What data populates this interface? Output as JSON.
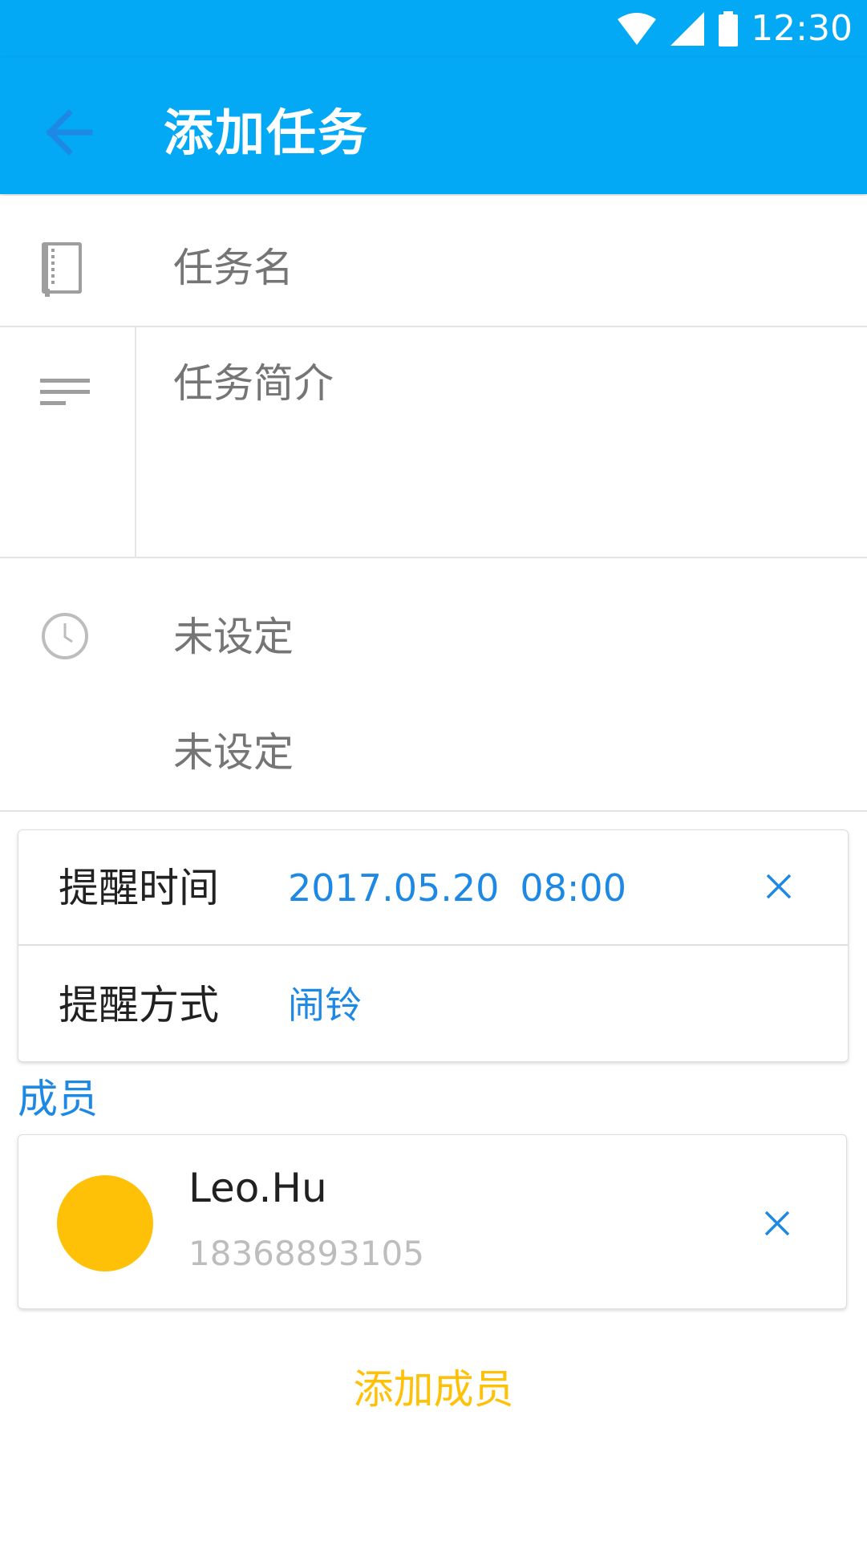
{
  "status_bar": {
    "time": "12:30",
    "icons": [
      "wifi-icon",
      "signal-icon",
      "battery-icon"
    ]
  },
  "app_bar": {
    "title": "添加任务",
    "back_icon": "arrow-back-icon"
  },
  "form": {
    "name_placeholder": "任务名",
    "description_placeholder": "任务简介",
    "start_time": "未设定",
    "end_time": "未设定"
  },
  "reminder": {
    "time_label": "提醒时间",
    "date": "2017.05.20",
    "time": "08:00",
    "method_label": "提醒方式",
    "method_value": "闹铃"
  },
  "members": {
    "title": "成员",
    "items": [
      {
        "name": "Leo.Hu",
        "phone": "18368893105"
      }
    ],
    "add_label": "添加成员"
  },
  "colors": {
    "primary": "#03A9F4",
    "accent_blue": "#1E88E5",
    "accent_yellow": "#FFC107",
    "hint_gray": "#757575"
  }
}
